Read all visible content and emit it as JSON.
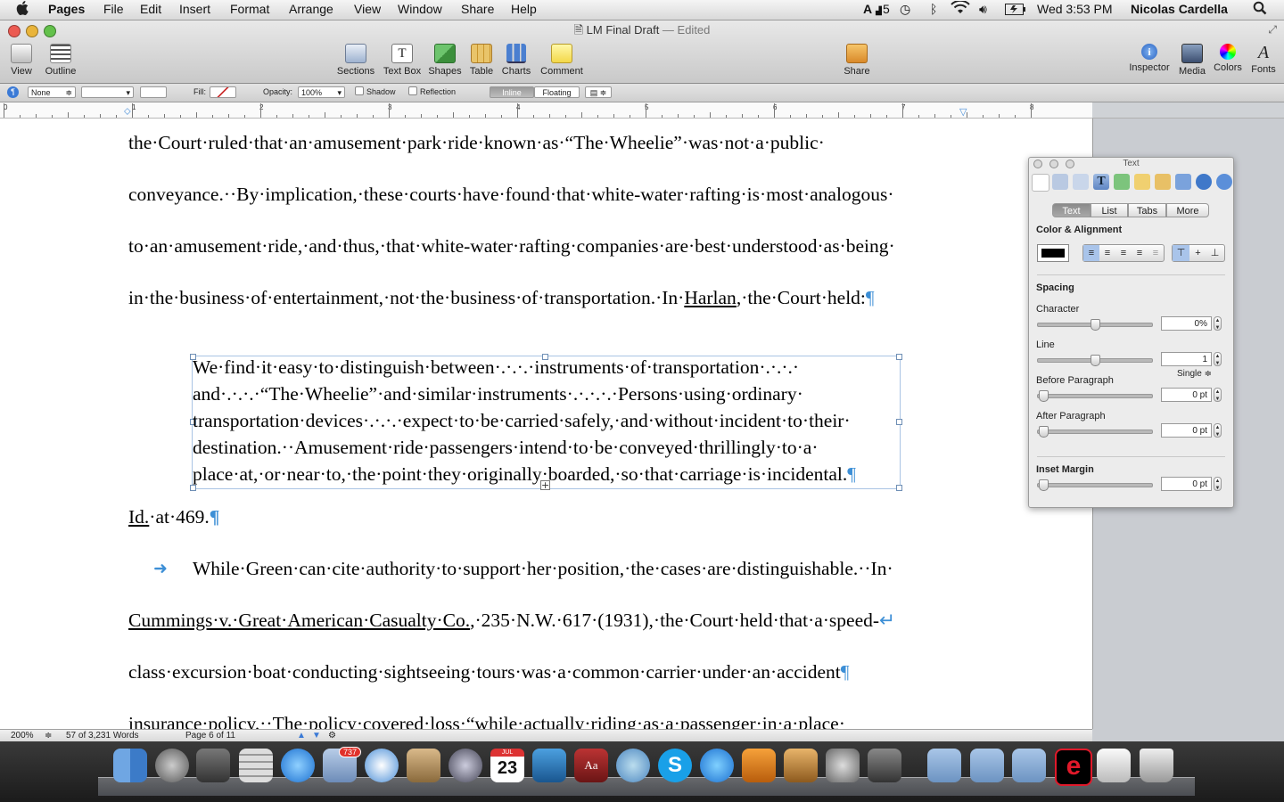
{
  "menubar": {
    "apple": "",
    "app": "Pages",
    "items": [
      "File",
      "Edit",
      "Insert",
      "Format",
      "Arrange",
      "View",
      "Window",
      "Share",
      "Help"
    ],
    "status": {
      "input_badge": "5",
      "clock": "Wed 3:53 PM",
      "user": "Nicolas Cardella"
    }
  },
  "window": {
    "title": "LM Final Draft",
    "edited": " — Edited"
  },
  "toolbar": {
    "view": "View",
    "outline": "Outline",
    "sections": "Sections",
    "textbox": "Text Box",
    "shapes": "Shapes",
    "table": "Table",
    "charts": "Charts",
    "comment": "Comment",
    "share": "Share",
    "inspector": "Inspector",
    "media": "Media",
    "colors": "Colors",
    "fonts": "Fonts"
  },
  "formatbar": {
    "stroke_style": "None",
    "fill_label": "Fill:",
    "opacity_label": "Opacity:",
    "opacity_value": "100%",
    "shadow": "Shadow",
    "reflection": "Reflection",
    "inline": "Inline",
    "floating": "Floating"
  },
  "ruler": {
    "numbers": [
      "0",
      "1",
      "2",
      "3",
      "4",
      "5",
      "6",
      "7",
      "8"
    ]
  },
  "document": {
    "lines": [
      "the·Court·ruled·that·an·amusement·park·ride·known·as·“The·Wheelie”·was·not·a·public·",
      "conveyance.··By·implication,·these·courts·have·found·that·white-water·rafting·is·most·analogous·",
      "to·an·amusement·ride,·and·thus,·that·white-water·rafting·companies·are·best·understood·as·being·",
      "in·the·business·of·entertainment,·not·the·business·of·transportation.·In·"
    ],
    "harlan": "Harlan",
    "line4_end": ",·the·Court·held:",
    "quote_lines": [
      "We·find·it·easy·to·distinguish·between·.·.·.·instruments·of·transportation·.·.·.·",
      "and·.·.·.·“The·Wheelie”·and·similar·instruments·.·.·.·.·Persons·using·ordinary·",
      "transportation·devices·.·.·.·expect·to·be·carried·safely,·and·without·incident·to·their·",
      "destination.··Amusement·ride·passengers·intend·to·be·conveyed·thrillingly·to·a·",
      "place·at,·or·near·to,·the·point·they·originally·boarded,·so·that·carriage·is·incidental."
    ],
    "id_cite": "Id.",
    "id_rest": "·at·469.",
    "arrow": "➜",
    "para2_line1": "While·Green·can·cite·authority·to·support·her·position,·the·cases·are·distinguishable.··In·",
    "cummings": "Cummings·v.·Great·American·Casualty·Co.",
    "para2_line2_rest": ",·235·N.W.·617·(1931),·the·Court·held·that·a·speed-",
    "para2_line3": "class·excursion·boat·conducting·sightseeing·tours·was·a·common·carrier·under·an·accident",
    "para2_line4": "insurance·policy.··The·policy·covered·loss·“while·actually·riding·as·a·passenger·in·a·place·",
    "pilcrow": "¶",
    "return_mark": "↵"
  },
  "statusbar": {
    "zoom": "200%",
    "words": "57 of 3,231 Words",
    "page": "Page 6 of 11"
  },
  "inspector": {
    "title": "Text",
    "tabs": [
      "Text",
      "List",
      "Tabs",
      "More"
    ],
    "color_alignment": "Color & Alignment",
    "spacing": "Spacing",
    "character": "Character",
    "character_value": "0%",
    "line": "Line",
    "line_value": "1",
    "line_mode": "Single ≑",
    "before_paragraph": "Before Paragraph",
    "before_value": "0 pt",
    "after_paragraph": "After Paragraph",
    "after_value": "0 pt",
    "inset_margin": "Inset Margin",
    "inset_value": "0 pt"
  },
  "dock": {
    "mail_badge": "737",
    "calendar_day": "23",
    "calendar_month": "JUL"
  },
  "colors": {
    "pilcrow": "#3d8fd6",
    "selection": "#a9c4e4",
    "dock": "#2a2a2a"
  }
}
